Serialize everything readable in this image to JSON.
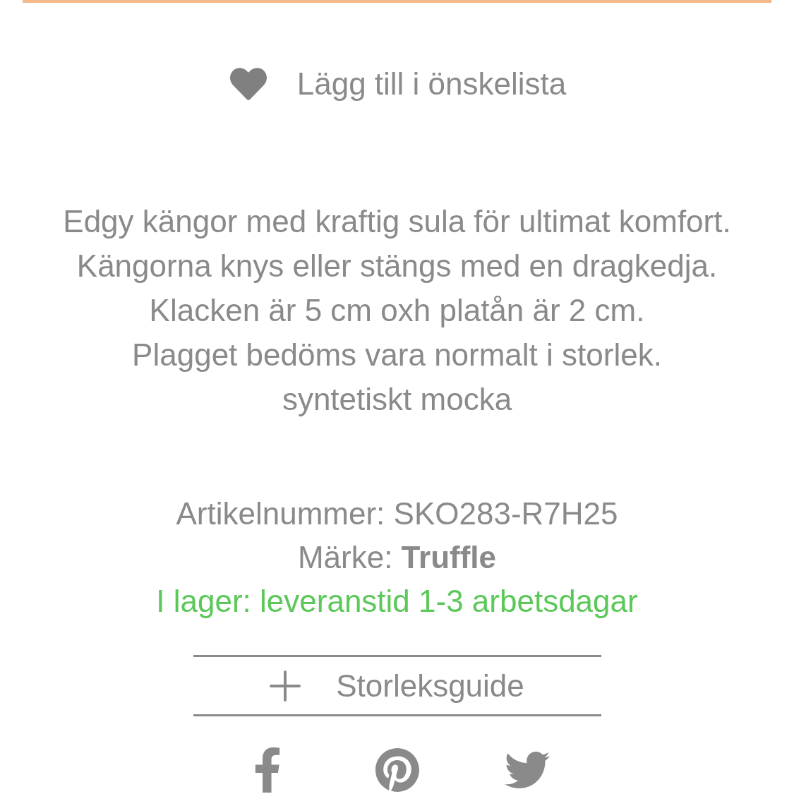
{
  "wishlist": {
    "label": "Lägg till i önskelista"
  },
  "description": [
    "Edgy kängor med kraftig sula för ultimat komfort. Kängorna knys eller stängs med en dragkedja. Klacken är 5 cm oxh platån är 2 cm.",
    "Plagget bedöms vara normalt i storlek.",
    "syntetiskt mocka"
  ],
  "article_number": "Artikelnummer: SKO283-R7H25",
  "brand": "Märke: **Truffle**",
  "stock": {
    "text": "I lager: leveranstid 1-3 arbetsdagar",
    "in_stock": true
  },
  "size_guide": {
    "label": "Storleksguide",
    "expanded": false
  },
  "share": [
    {
      "kind": "facebook"
    },
    {
      "kind": "pinterest"
    },
    {
      "kind": "twitter"
    }
  ]
}
